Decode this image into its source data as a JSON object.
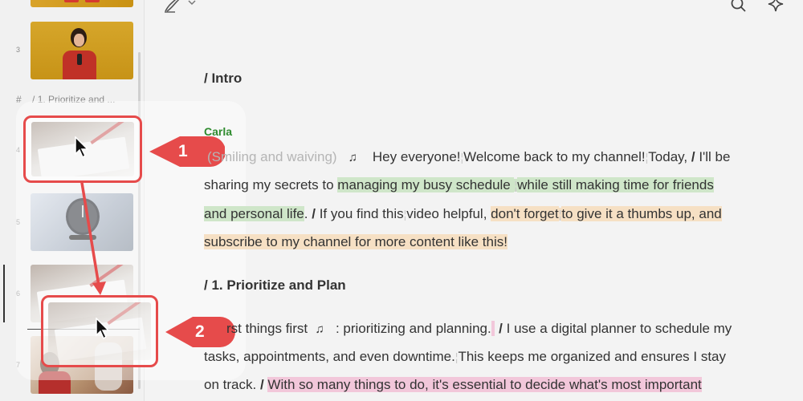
{
  "colors": {
    "accent_red": "#e64b4b",
    "speaker_green": "#2e8b2e",
    "highlight_green": "#cfe6c9",
    "highlight_orange": "#f6e0c4",
    "highlight_pink": "#f2c7da"
  },
  "toolbar": {
    "pen_icon": "pen-icon",
    "dropdown_icon": "chevron-down-icon",
    "search_icon": "search-icon",
    "ai_icon": "sparkle-icon"
  },
  "sidebar": {
    "slides": [
      {
        "number": "3"
      },
      {
        "number": "4"
      },
      {
        "number": "5"
      },
      {
        "number": "6"
      },
      {
        "number": "7"
      }
    ],
    "section_hash": "#",
    "section_label": "/ 1. Prioritize and ..."
  },
  "steps": {
    "step1": "1",
    "step2": "2"
  },
  "doc": {
    "heading_intro": "/ Intro",
    "speaker": "Carla",
    "p1": {
      "l1_muted": "(Smiling and waiving)",
      "l1_note": "♫",
      "l1_a": "Hey everyone!",
      "l1_b": "Welcome back to my channel!",
      "l1_c": "Today,",
      "l1_slash": "/",
      "l1_d": "I'll be",
      "l2_a": "sharing my secrets to",
      "l2_hl1": "managing my busy schedule ",
      "l2_hl2": "while still making time for friends",
      "l3_hl": "and personal life",
      "l3_a": ".",
      "l3_slash": "/",
      "l3_b": "If you find this",
      "l3_c": "video helpful,",
      "l3_hl2": "don't forget",
      "l3_hl3": "to give it a thumbs up, and",
      "l4_hl": "subscribe to my channel for more content like this!"
    },
    "heading_prioritize": "/ 1. Prioritize and Plan",
    "p2": {
      "l1_a": "rst things first",
      "l1_note": "♫",
      "l1_b": ": prioritizing and planning.",
      "l1_slash": "/",
      "l1_c": "I use a digital planner to schedule my",
      "l2_a": "tasks, appointments, and even downtime.",
      "l2_b": "This keeps me organized and ensures I stay",
      "l3_a": "on track.",
      "l3_slash": "/",
      "l3_hl": "With so many things to do, it's essential to decide what's most important"
    }
  }
}
